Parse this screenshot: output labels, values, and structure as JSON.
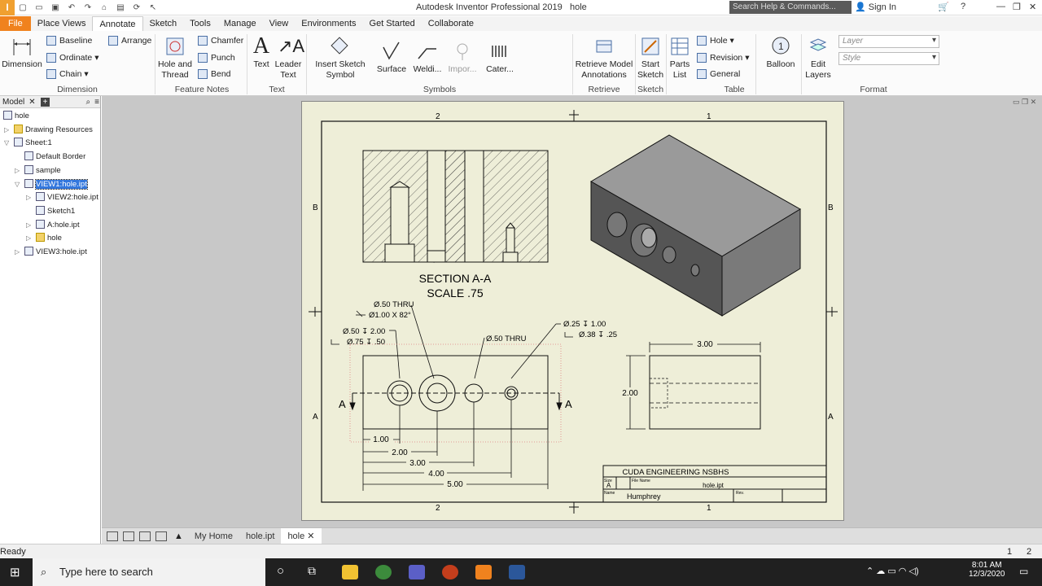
{
  "app": {
    "title": "Autodesk Inventor Professional 2019",
    "doc": "hole",
    "search_placeholder": "Search Help & Commands...",
    "sign_in": "Sign In"
  },
  "tabs": [
    "File",
    "Place Views",
    "Annotate",
    "Sketch",
    "Tools",
    "Manage",
    "View",
    "Environments",
    "Get Started",
    "Collaborate"
  ],
  "ribbon": {
    "dimension": {
      "label": "Dimension",
      "baseline": "Baseline",
      "ordinate": "Ordinate",
      "chain": "Chain",
      "arrange": "Arrange",
      "group": "Dimension"
    },
    "feature_notes": {
      "hole_thread": "Hole and Thread",
      "chamfer": "Chamfer",
      "punch": "Punch",
      "bend": "Bend",
      "group": "Feature Notes"
    },
    "text": {
      "text": "Text",
      "leader": "Leader Text",
      "group": "Text"
    },
    "symbols": {
      "insert": "Insert Sketch Symbol",
      "surface": "Surface",
      "welding": "Weldi...",
      "import": "Impor...",
      "caterpillar": "Cater...",
      "group": "Symbols"
    },
    "retrieve": {
      "label": "Retrieve Model Annotations",
      "group": "Retrieve"
    },
    "sketch": {
      "label": "Start Sketch",
      "group": "Sketch"
    },
    "table": {
      "parts": "Parts List",
      "hole": "Hole",
      "revision": "Revision",
      "general": "General",
      "group": "Table"
    },
    "balloon": "Balloon",
    "format": {
      "edit_layers": "Edit Layers",
      "layer": "Layer",
      "style": "Style",
      "group": "Format"
    }
  },
  "browser": {
    "tab": "Model",
    "nodes": [
      "hole",
      "Drawing Resources",
      "Sheet:1",
      "Default Border",
      "sample",
      "VIEW1:hole.ipt",
      "VIEW2:hole.ipt",
      "Sketch1",
      "A:hole.ipt",
      "hole",
      "VIEW3:hole.ipt"
    ]
  },
  "drawing": {
    "zone_top": [
      "2",
      "1"
    ],
    "zone_side": [
      "B",
      "A"
    ],
    "section_title": "SECTION A-A",
    "section_scale": "SCALE .75",
    "notes": {
      "n1a": "Ø.50 THRU",
      "n1b": "Ø1.00 X 82°",
      "n2a": "Ø.50 ↧ 2.00",
      "n2b": "Ø.75 ↧ .50",
      "n3": "Ø.50 THRU",
      "n4a": "Ø.25 ↧ 1.00",
      "n4b": "Ø.38 ↧ .25"
    },
    "section_mark": "A",
    "dims": [
      "1.00",
      "2.00",
      "3.00",
      "4.00",
      "5.00"
    ],
    "side_dims": {
      "width": "3.00",
      "height": "2.00"
    },
    "title_block": {
      "company": "CUDA ENGINEERING NSBHS",
      "size_label": "Size",
      "size": "A",
      "file_label": "File Name",
      "file": "hole.ipt",
      "name_label": "Name",
      "name": "Humphrey",
      "rev_label": "Rev."
    }
  },
  "doc_tabs": [
    "My Home",
    "hole.ipt",
    "hole"
  ],
  "status": {
    "text": "Ready",
    "page1": "1",
    "page2": "2"
  },
  "taskbar": {
    "search": "Type here to search",
    "time": "8:01 AM",
    "date": "12/3/2020"
  },
  "colors": {
    "file_tab": "#f0821e",
    "canvas": "#c8c8c8",
    "sheet": "#eeeed8",
    "iso_dark": "#555555",
    "iso_mid": "#7a7a7a",
    "iso_top": "#9a9a9a"
  }
}
